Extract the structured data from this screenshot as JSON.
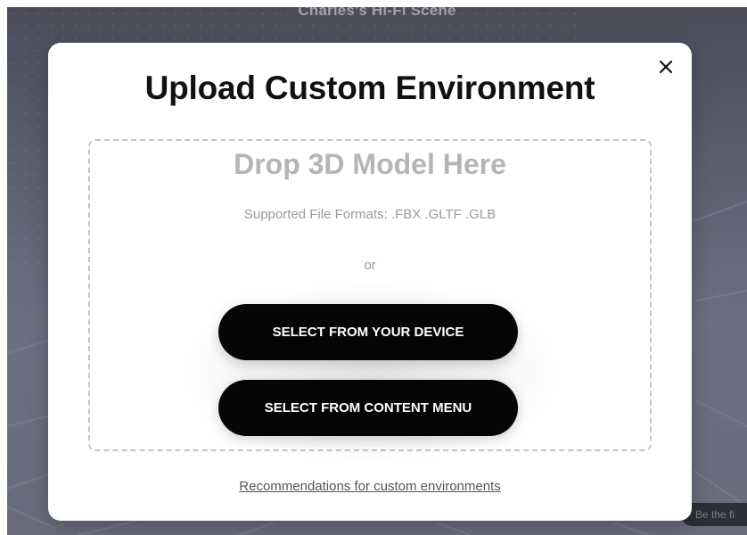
{
  "scene": {
    "title": "Charles's Hi-Fi Scene",
    "corner_text": "Be the fi"
  },
  "modal": {
    "title": "Upload Custom Environment",
    "close_icon": "close-icon",
    "close_glyph": "✕"
  },
  "dropzone": {
    "title": "Drop 3D Model Here",
    "formats": "Supported File Formats: .FBX .GLTF .GLB",
    "or_text": "or",
    "buttons": {
      "device": "SELECT FROM YOUR DEVICE",
      "content_menu": "SELECT FROM CONTENT MENU"
    }
  },
  "footer": {
    "link": "Recommendations for custom environments"
  },
  "colors": {
    "button_bg": "#050505",
    "modal_bg": "#ffffff",
    "scene_bg": "#5c5f70"
  }
}
